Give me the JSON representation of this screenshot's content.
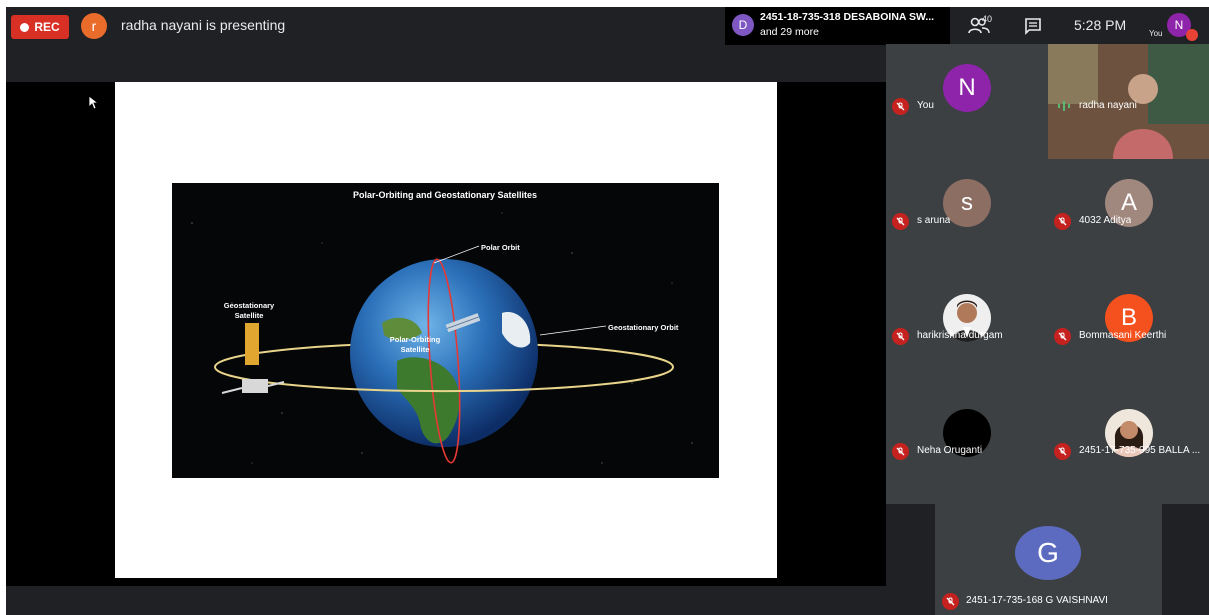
{
  "topbar": {
    "rec_label": "REC",
    "presenter_initial": "r",
    "presenting_text": "radha nayani is presenting",
    "notification": {
      "initial": "D",
      "line1": "2451-18-735-318 DESABOINA SW...",
      "line2": "and 29 more"
    },
    "people_count": "40",
    "time": "5:28 PM",
    "self_label": "You",
    "self_initial": "N"
  },
  "slide": {
    "title": "Polar-Orbiting and Geostationary Satellites",
    "labels": {
      "polar_orbit": "Polar Orbit",
      "geostationary_orbit": "Geostationary Orbit",
      "geostationary_satellite_1": "Geostationary",
      "geostationary_satellite_2": "Satellite",
      "polar_satellite_1": "Polar-Orbiting",
      "polar_satellite_2": "Satellite"
    }
  },
  "participants": [
    {
      "initial": "N",
      "name": "You",
      "color": "#8e24aa"
    },
    {
      "initial": "",
      "name": "radha nayani",
      "color": "#5d4037"
    },
    {
      "initial": "s",
      "name": "s aruna",
      "color": "#8d6e63"
    },
    {
      "initial": "A",
      "name": "4032 Aditya",
      "color": "#a1887f"
    },
    {
      "initial": "",
      "name": "harikrishna durgam",
      "color": "#efefef"
    },
    {
      "initial": "B",
      "name": "Bommasani Keerthi",
      "color": "#f4511e"
    },
    {
      "initial": "",
      "name": "Neha Oruganti",
      "color": "#000000"
    },
    {
      "initial": "",
      "name": "2451-17-735-095 BALLA ...",
      "color": "#efe7dc"
    }
  ],
  "bottom_participant": {
    "initial": "G",
    "name": "2451-17-735-168 G VAISHNAVI",
    "color": "#5c6bc0"
  }
}
